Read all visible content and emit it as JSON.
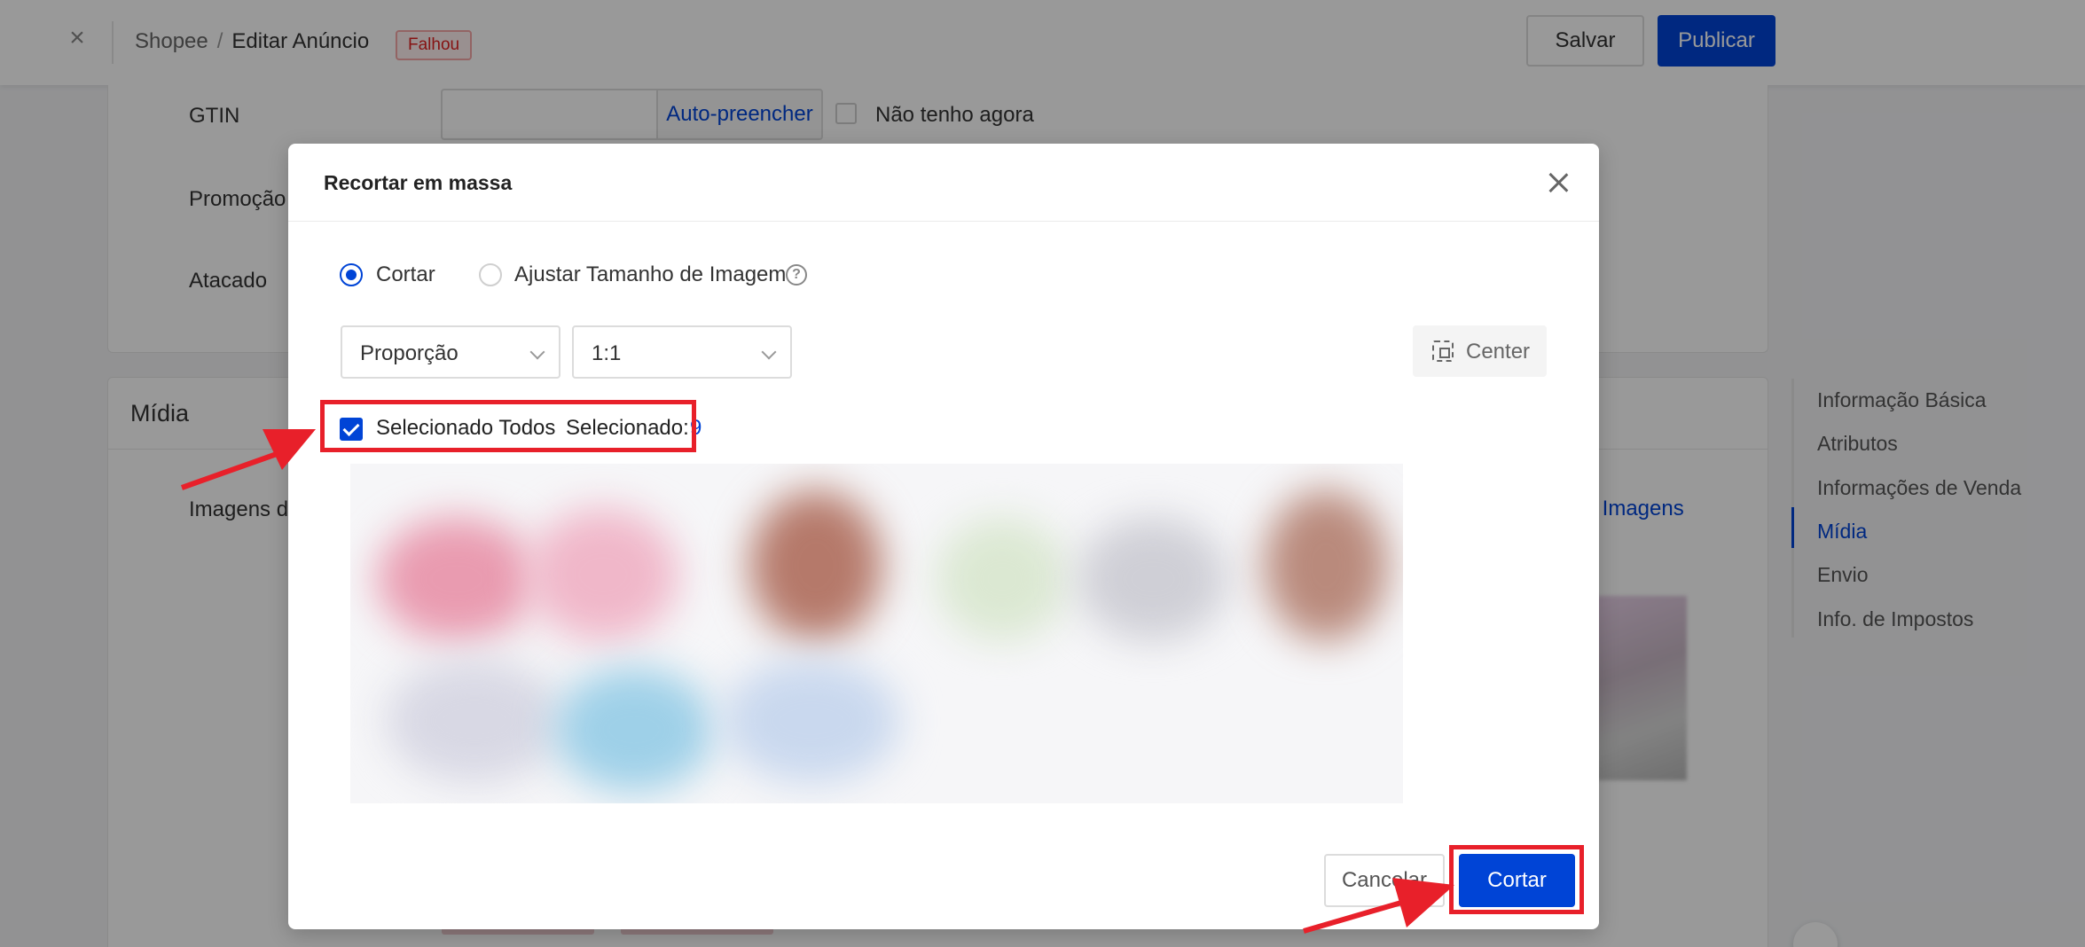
{
  "header": {
    "breadcrumb_root": "Shopee",
    "breadcrumb_separator": "/",
    "breadcrumb_current": "Editar Anúncio",
    "status_badge": "Falhou",
    "save_label": "Salvar",
    "publish_label": "Publicar"
  },
  "form": {
    "gtin_label": "GTIN",
    "gtin_autofill_label": "Auto-preencher",
    "gtin_none_label": "Não tenho agora",
    "promotion_label": "Promoção",
    "wholesale_label": "Atacado"
  },
  "media": {
    "title": "Mídia",
    "images_label": "Imagens de",
    "right_link": "r Imagens"
  },
  "anchor_nav": {
    "items": [
      {
        "label": "Informação Básica"
      },
      {
        "label": "Atributos"
      },
      {
        "label": "Informações de Venda"
      },
      {
        "label": "Mídia",
        "active": true
      },
      {
        "label": "Envio"
      },
      {
        "label": "Info. de Impostos"
      }
    ]
  },
  "modal": {
    "title": "Recortar em massa",
    "mode_options": [
      {
        "label": "Cortar",
        "selected": true
      },
      {
        "label": "Ajustar Tamanho de Imagem",
        "selected": false
      }
    ],
    "help_icon": "?",
    "type_select": "Proporção",
    "ratio_select": "1:1",
    "center_label": "Center",
    "select_all_label": "Selecionado Todos",
    "select_all_checked": true,
    "selected_count_label": "Selecionado:",
    "selected_count_value": "9",
    "cancel_label": "Cancelar",
    "confirm_label": "Cortar"
  },
  "colors": {
    "primary": "#0044d6",
    "annotation_red": "#e8202a",
    "fail_badge": "#e02020"
  },
  "icons": [
    "close-icon",
    "help-circle-icon",
    "chevron-down-icon",
    "center-focus-icon",
    "checkbox-checked-icon",
    "annotation-arrow"
  ]
}
